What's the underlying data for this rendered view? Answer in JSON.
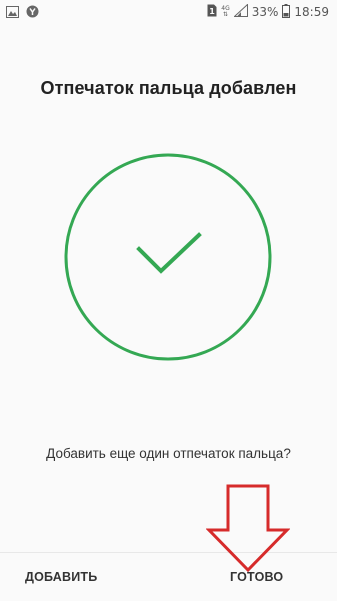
{
  "status_bar": {
    "sim_label": "1",
    "network_label": "4G",
    "battery_percent": "33%",
    "time": "18:59",
    "icons": [
      "gallery-icon",
      "yandex-icon",
      "sim-icon",
      "signal-icon",
      "battery-icon"
    ]
  },
  "screen": {
    "title": "Отпечаток пальца добавлен",
    "question": "Добавить еще один отпечаток пальца?",
    "success_icon": "checkmark-circle-icon"
  },
  "bottom_bar": {
    "add_label": "ДОБАВИТЬ",
    "done_label": "ГОТОВО"
  },
  "colors": {
    "accent_green": "#34a853",
    "annotation_red": "#d62b2b",
    "background": "#fafafa",
    "text": "#222222"
  }
}
